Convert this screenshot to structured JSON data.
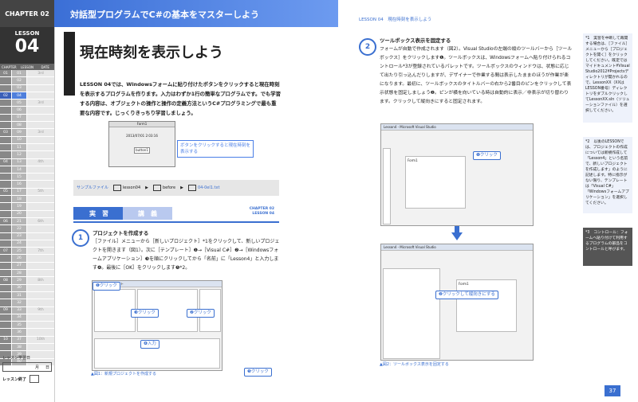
{
  "sidebar": {
    "chapter": "CHAPTER 02",
    "lesson_label": "LESSON",
    "lesson_no": "04",
    "cols": [
      "CHAPTER",
      "LESSON",
      "DATE"
    ],
    "rows": [
      {
        "c1": "01",
        "c2": "01",
        "c3": "3rd"
      },
      {
        "c1": "",
        "c2": "02",
        "c3": ""
      },
      {
        "c1": "",
        "c2": "03",
        "c3": ""
      },
      {
        "c1": "02",
        "c2": "04",
        "c3": "",
        "cur": true
      },
      {
        "c1": "",
        "c2": "05",
        "c3": "3rd"
      },
      {
        "c1": "",
        "c2": "06",
        "c3": ""
      },
      {
        "c1": "",
        "c2": "07",
        "c3": ""
      },
      {
        "c1": "",
        "c2": "08",
        "c3": ""
      },
      {
        "c1": "03",
        "c2": "09",
        "c3": "3rd"
      },
      {
        "c1": "",
        "c2": "10",
        "c3": ""
      },
      {
        "c1": "",
        "c2": "11",
        "c3": ""
      },
      {
        "c1": "",
        "c2": "12",
        "c3": ""
      },
      {
        "c1": "04",
        "c2": "13",
        "c3": "4th"
      },
      {
        "c1": "",
        "c2": "14",
        "c3": ""
      },
      {
        "c1": "",
        "c2": "15",
        "c3": ""
      },
      {
        "c1": "",
        "c2": "16",
        "c3": ""
      },
      {
        "c1": "05",
        "c2": "17",
        "c3": "5th"
      },
      {
        "c1": "",
        "c2": "18",
        "c3": ""
      },
      {
        "c1": "",
        "c2": "19",
        "c3": ""
      },
      {
        "c1": "",
        "c2": "20",
        "c3": ""
      },
      {
        "c1": "06",
        "c2": "21",
        "c3": "6th"
      },
      {
        "c1": "",
        "c2": "22",
        "c3": ""
      },
      {
        "c1": "",
        "c2": "23",
        "c3": ""
      },
      {
        "c1": "",
        "c2": "24",
        "c3": ""
      },
      {
        "c1": "07",
        "c2": "25",
        "c3": "7th"
      },
      {
        "c1": "",
        "c2": "26",
        "c3": ""
      },
      {
        "c1": "",
        "c2": "27",
        "c3": ""
      },
      {
        "c1": "",
        "c2": "28",
        "c3": ""
      },
      {
        "c1": "08",
        "c2": "29",
        "c3": "8th"
      },
      {
        "c1": "",
        "c2": "30",
        "c3": ""
      },
      {
        "c1": "",
        "c2": "31",
        "c3": ""
      },
      {
        "c1": "",
        "c2": "32",
        "c3": ""
      },
      {
        "c1": "09",
        "c2": "33",
        "c3": "9th"
      },
      {
        "c1": "",
        "c2": "34",
        "c3": ""
      },
      {
        "c1": "",
        "c2": "35",
        "c3": ""
      },
      {
        "c1": "",
        "c2": "36",
        "c3": ""
      },
      {
        "c1": "10",
        "c2": "37",
        "c3": "10th"
      },
      {
        "c1": "",
        "c2": "38",
        "c3": ""
      },
      {
        "c1": "",
        "c2": "39",
        "c3": ""
      },
      {
        "c1": "",
        "c2": "40",
        "c3": ""
      }
    ],
    "progress_label": "レッスン学習日",
    "progress_month": "月",
    "progress_day": "日",
    "finish_label": "レッスン終了"
  },
  "header": {
    "left_title": "対話型プログラムでC#の基本をマスターしよう",
    "right_title": "LESSON 04　現在時刻を表示しよう"
  },
  "left": {
    "title": "現在時刻を表示しよう",
    "intro": "LESSON 04では、Windowsフォームに貼り付けたボタンをクリックすると現在時刻を表示するプログラムを作ります。入力はわずか1行の簡単なプログラムです。でも学習する内容は、オブジェクトの操作と操作の定義方法というC#プログラミングで最も重要な内容です。じっくりきっちり学習しましょう。",
    "fig0_title": "Form1",
    "fig0_text": "2013/07/01 2:03:16",
    "fig0_btn": "button1",
    "fig0_callout": "ボタンをクリックすると現在時刻を表示する",
    "sample_label": "サンプルファイル",
    "path": [
      "lesson04",
      "before",
      "04-0el1.txt"
    ],
    "tab_active": "実　習",
    "tab_inactive": "講　義",
    "tab_chapter": "CHAPTER 02",
    "tab_lesson": "LESSON 04",
    "step1_no": "1",
    "step1_head": "プロジェクトを作成する",
    "step1_body": "［ファイル］メニューから［新しいプロジェクト］*1をクリックして、新しいプロジェクトを開きます（図1）。次に［テンプレート］❶→［Visual C#］❷→［Windowsフォームアプリケーション］❸を順にクリックしてから「名前」に「Lesson4」と入力します❹。最後に［OK］をクリックします❺*2。",
    "fig1_title": "新しいプロジェクト",
    "badges": [
      "❶クリック",
      "❷クリック",
      "❸クリック",
      "❹入力",
      "❺クリック"
    ],
    "fig1_caption": "▲図1：新規プロジェクトを作成する"
  },
  "right": {
    "step2_no": "2",
    "step2_head": "ツールボックス表示を固定する",
    "step2_body": "フォームが自動で作成されます（図2）。Visual Studioの左端の縦のツールバーから［ツールボックス］をクリックします❶。ツールボックスは、Windowsフォームへ貼り付けられるコントロール*3が登録されているパレットです。ツールボックスのウィンドウは、状態に応じて出たり引っ込んだりしますが、デザイナーで作業する間は表示したままのほうが作業が楽になります。最初に、ツールボックスのタイトルバーの右から2番目のピンをクリックして表示状態を固定しましょう❷。ピンが横を向いている時は自動的に表示／非表示が切り替わります。クリックして縦向きにすると固定されます。",
    "fig2a_title": "Lesson4 - Microsoft Visual Studio",
    "fig2a_badge": "❶クリック",
    "fig2b_title": "Lesson4 - Microsoft Visual Studio",
    "fig2b_badge": "❷クリックして縦向きにする",
    "form_label": "Form1",
    "fig2_caption": "▲図2：ツールボックス表示を固定する",
    "note1": "*1　実習を中断して再開する場合は、［ファイル］メニューから［プロジェクトを開く］をクリックしてください。既定ではマイドキュメント¥Visual Studio2012¥Projectsディレクトリが開かれるので、LessonXX（XXはLESSON番号）ディレクトリをダブルクリックしてLessonXX.sln（ソリューションファイル）を選択してください。",
    "note2": "*2　以後のLESSONでは、プロジェクトの作成については新規作成して「Lesson4」という名前で、新しいプロジェクトを作成します」のように記述します。特に指示がない限り、テンプレートは「Visual C#」「Windowsフォームアプリケーション」を選択してください。",
    "note3": "*3　コントロール：フォームへ貼り付けて利用するプログラムの部品をコントロールと呼びます。",
    "page_no": "37"
  }
}
